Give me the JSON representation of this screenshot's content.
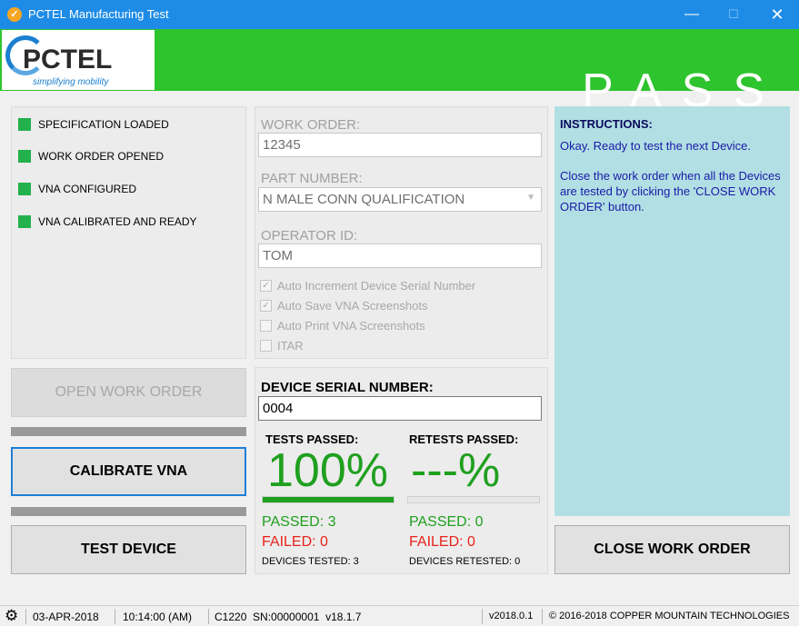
{
  "window": {
    "title": "PCTEL Manufacturing Test"
  },
  "header": {
    "logo_text": "PCTEL",
    "logo_tagline": "simplifying mobility",
    "result_text": "PASS"
  },
  "status_list": [
    {
      "label": "SPECIFICATION LOADED"
    },
    {
      "label": "WORK ORDER OPENED"
    },
    {
      "label": "VNA CONFIGURED"
    },
    {
      "label": "VNA CALIBRATED AND READY"
    }
  ],
  "buttons": {
    "open_work_order": "OPEN WORK ORDER",
    "calibrate_vna": "CALIBRATE VNA",
    "test_device": "TEST DEVICE",
    "close_work_order": "CLOSE WORK ORDER"
  },
  "form": {
    "work_order_label": "WORK ORDER:",
    "work_order_value": "12345",
    "part_number_label": "PART NUMBER:",
    "part_number_value": "N MALE CONN QUALIFICATION",
    "operator_label": "OPERATOR ID:",
    "operator_value": "TOM",
    "options": [
      {
        "label": "Auto Increment Device Serial Number",
        "checked": true
      },
      {
        "label": "Auto Save VNA Screenshots",
        "checked": true
      },
      {
        "label": "Auto Print VNA Screenshots",
        "checked": false
      },
      {
        "label": "ITAR",
        "checked": false
      }
    ]
  },
  "results": {
    "serial_label": "DEVICE SERIAL NUMBER:",
    "serial_value": "0004",
    "tests_passed_label": "TESTS PASSED:",
    "tests_passed_pct": "100%",
    "tests_progress": 1.0,
    "retests_passed_label": "RETESTS PASSED:",
    "retests_passed_pct": "---%",
    "retests_progress": 0.0,
    "passed": "PASSED: 3",
    "failed": "FAILED: 0",
    "devices_tested": "DEVICES TESTED: 3",
    "retest_passed": "PASSED: 0",
    "retest_failed": "FAILED: 0",
    "devices_retested": "DEVICES RETESTED: 0"
  },
  "instructions": {
    "title": "INSTRUCTIONS:",
    "line1": "Okay. Ready to test the next Device.",
    "line2": "Close the work order when all the Devices are tested by clicking the 'CLOSE WORK ORDER' button."
  },
  "statusbar": {
    "date": "03-APR-2018",
    "time": "10:14:00 (AM)",
    "device_info": "C1220  SN:00000001  v18.1.7",
    "version": "v2018.0.1",
    "copyright": "© 2016-2018 COPPER MOUNTAIN TECHNOLOGIES"
  },
  "colors": {
    "title_bar": "#1e8ce6",
    "pass_green": "#2ec42e",
    "instructions_bg": "#b1dfe4"
  }
}
